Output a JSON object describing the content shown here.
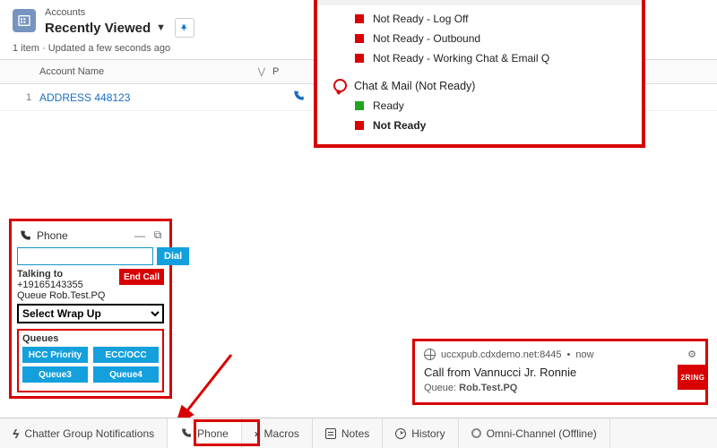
{
  "header": {
    "object_label": "Accounts",
    "listview": "Recently Viewed",
    "meta": "1 item · Updated a few seconds ago"
  },
  "table": {
    "col_account": "Account Name",
    "col_phone_initial": "P",
    "row_number": "1",
    "account_link": "ADDRESS 448123"
  },
  "status": {
    "items_top": [
      "Not Ready - Log Off",
      "Not Ready - Outbound",
      "Not Ready - Working Chat & Email Q"
    ],
    "chat_section": "Chat & Mail (Not Ready)",
    "ready": "Ready",
    "not_ready": "Not Ready"
  },
  "softphone": {
    "title": "Phone",
    "dial_btn": "Dial",
    "talking_label": "Talking to",
    "end_call": "End Call",
    "caller": "+19165143355",
    "queue_label": "Queue",
    "queue_value": "Rob.Test.PQ",
    "wrap_placeholder": "Select Wrap Up",
    "queues_title": "Queues",
    "queues": [
      "HCC Priority",
      "ECC/OCC",
      "Queue3",
      "Queue4"
    ]
  },
  "toast": {
    "origin": "uccxpub.cdxdemo.net:8445",
    "time": "now",
    "title": "Call from Vannucci Jr. Ronnie",
    "sub_label": "Queue:",
    "sub_value": "Rob.Test.PQ",
    "brand": "2RING"
  },
  "utilbar": {
    "chatter": "Chatter Group Notifications",
    "phone": "Phone",
    "macros": "Macros",
    "notes": "Notes",
    "history": "History",
    "omni": "Omni-Channel (Offline)"
  }
}
